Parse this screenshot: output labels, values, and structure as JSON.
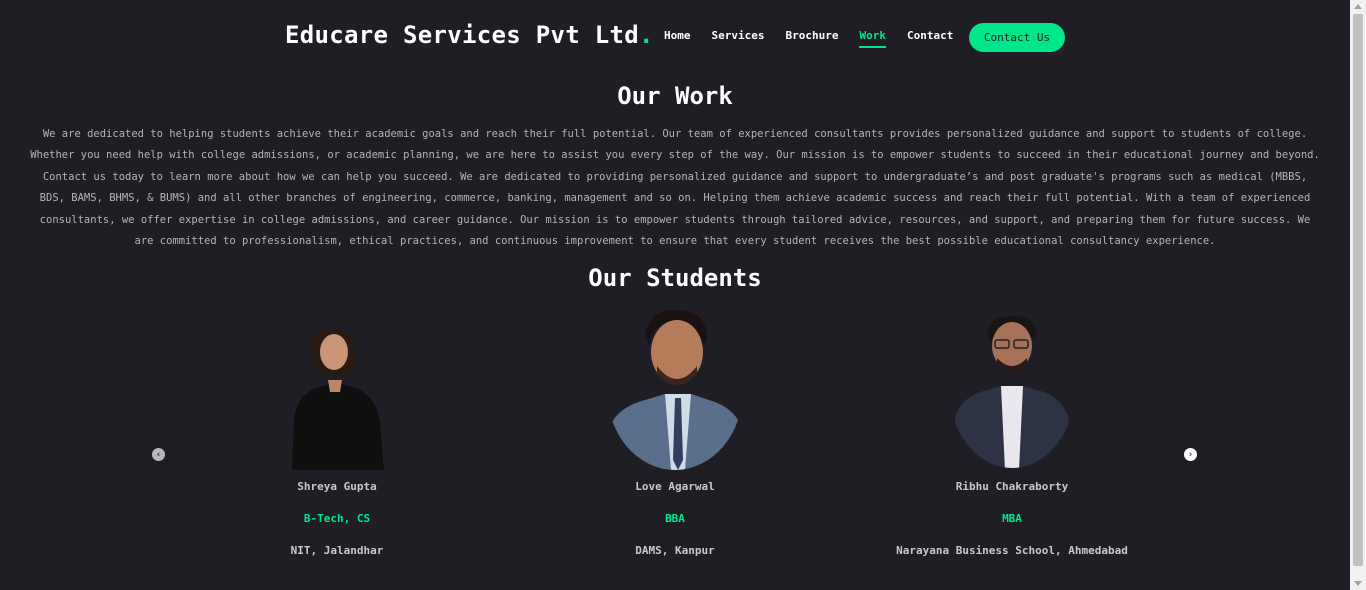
{
  "brand": {
    "name": "Educare Services Pvt Ltd",
    "dot": "."
  },
  "nav": {
    "items": [
      "Home",
      "Services",
      "Brochure",
      "Work",
      "Contact"
    ],
    "active": "Work",
    "cta_label": "Contact Us"
  },
  "work": {
    "title": "Our Work",
    "text": "We are dedicated to helping students achieve their academic goals and reach their full potential. Our team of experienced consultants provides personalized guidance and support to students of college. Whether you need help with college admissions, or academic planning, we are here to assist you every step of the way. Our mission is to empower students to succeed in their educational journey and beyond. Contact us today to learn more about how we can help you succeed. We are dedicated to providing personalized guidance and support to undergraduate’s and post graduate's programs such as medical (MBBS, BDS, BAMS, BHMS, & BUMS) and all other branches of engineering, commerce, banking, management and so on. Helping them achieve academic success and reach their full potential. With a team of experienced consultants, we offer expertise in college admissions, and career guidance. Our mission is to empower students through tailored advice, resources, and support, and preparing them for future success. We are committed to professionalism, ethical practices, and continuous improvement to ensure that every student receives the best possible educational consultancy experience."
  },
  "students": {
    "title": "Our Students",
    "items": [
      {
        "name": "Shreya Gupta",
        "course": "B-Tech, CS",
        "college": "NIT, Jalandhar"
      },
      {
        "name": "Love Agarwal",
        "course": "BBA",
        "college": "DAMS, Kanpur"
      },
      {
        "name": "Ribhu Chakraborty",
        "course": "MBA",
        "college": "Narayana Business School, Ahmedabad"
      }
    ]
  },
  "carousel": {
    "prev_icon": "‹",
    "next_icon": "›"
  },
  "colors": {
    "background": "#1f1e24",
    "accent": "#00e68a",
    "text_muted": "#b5b5b5"
  }
}
